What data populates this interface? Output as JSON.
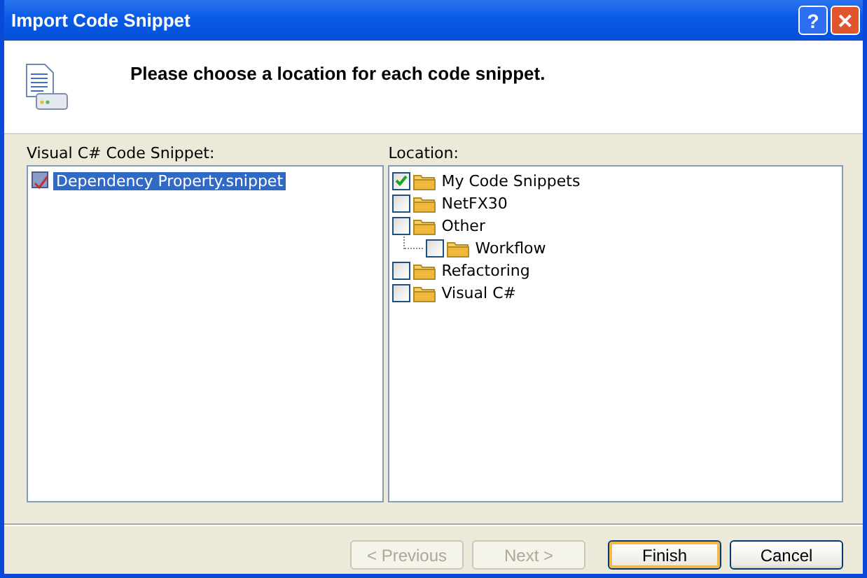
{
  "window": {
    "title": "Import Code Snippet",
    "title_buttons": [
      {
        "kind": "help",
        "label": "?"
      },
      {
        "kind": "close",
        "label": "✕"
      }
    ]
  },
  "header": {
    "instruction": "Please choose a location for each code snippet."
  },
  "snippets": {
    "label": "Visual C# Code Snippet:",
    "items": [
      {
        "name": "Dependency Property.snippet",
        "selected": true
      }
    ]
  },
  "locations": {
    "label": "Location:",
    "items": [
      {
        "name": "My Code Snippets",
        "checked": true
      },
      {
        "name": "NetFX30",
        "checked": false
      },
      {
        "name": "Other",
        "checked": false,
        "children": [
          {
            "name": "Workflow",
            "checked": false
          }
        ]
      },
      {
        "name": "Refactoring",
        "checked": false
      },
      {
        "name": "Visual C#",
        "checked": false
      }
    ]
  },
  "buttons": [
    {
      "label": "< Previous",
      "disabled": true,
      "default": false
    },
    {
      "label": "Next >",
      "disabled": true,
      "default": false
    },
    {
      "label": "Finish",
      "disabled": false,
      "default": true
    },
    {
      "label": "Cancel",
      "disabled": false,
      "default": false
    }
  ]
}
